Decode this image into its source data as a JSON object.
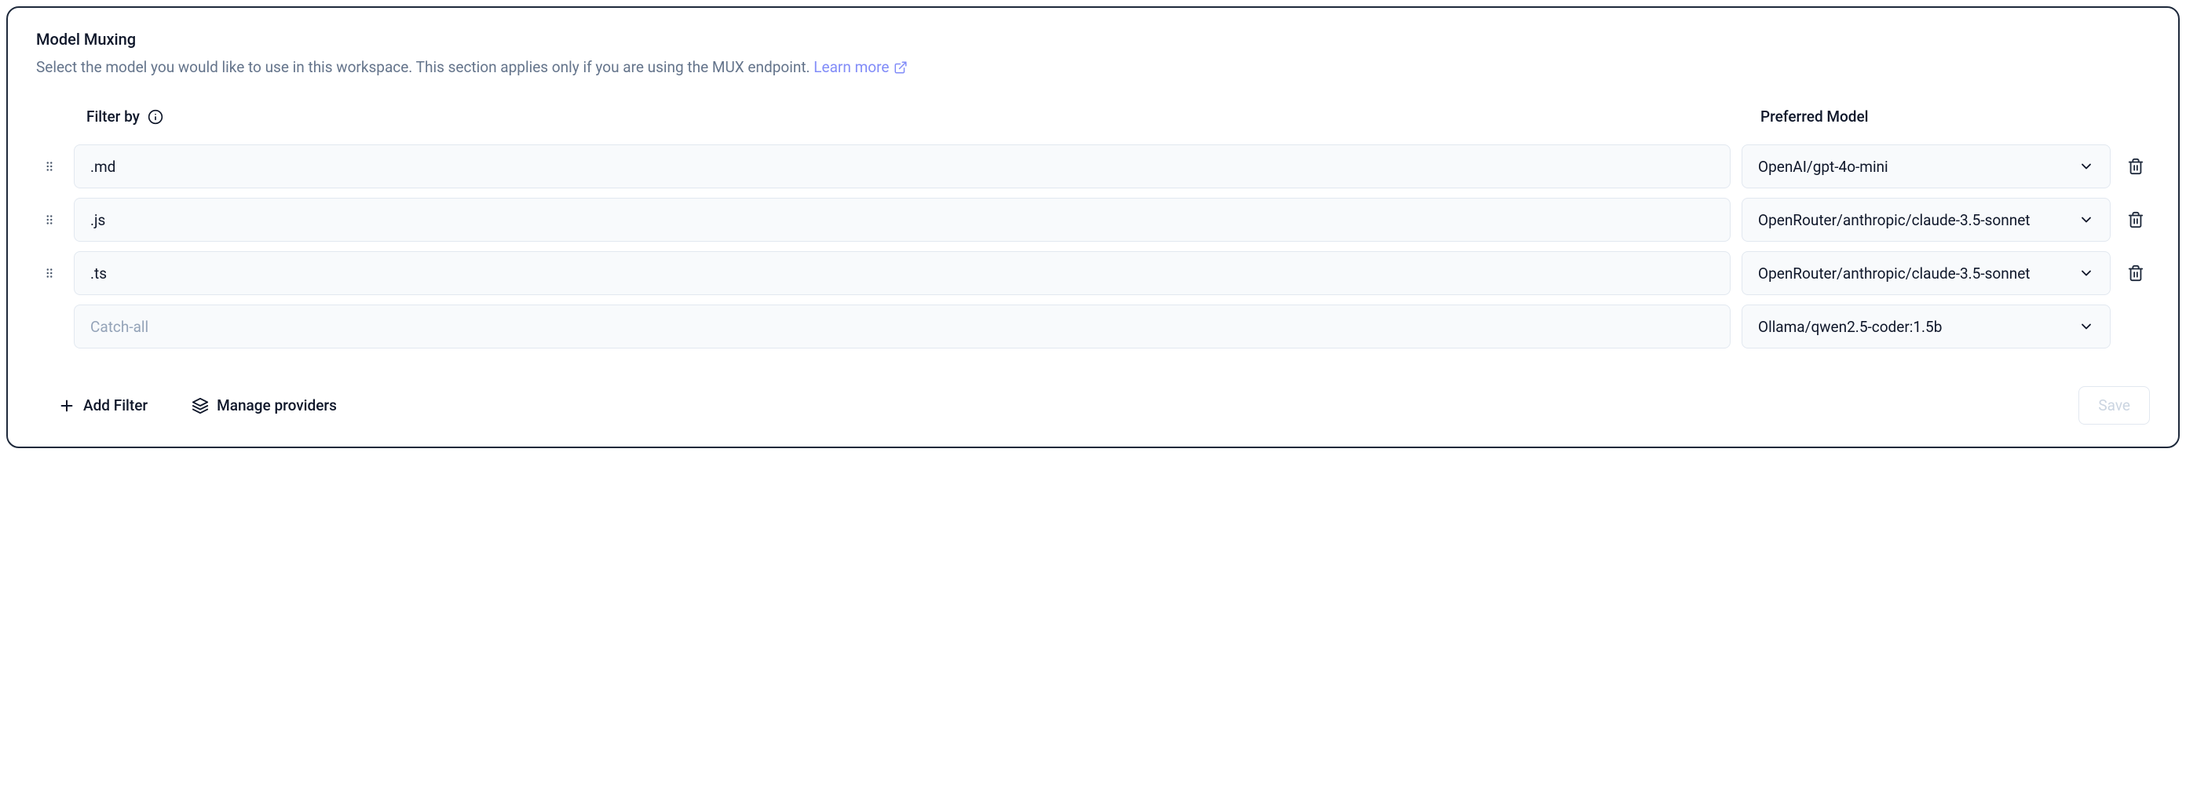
{
  "title": "Model Muxing",
  "description": "Select the model you would like to use in this workspace. This section applies only if you are using the MUX endpoint.",
  "learn_more_label": "Learn more",
  "headers": {
    "filter_by": "Filter by",
    "preferred_model": "Preferred Model"
  },
  "rows": [
    {
      "filter_value": ".md",
      "filter_placeholder": "",
      "model": "OpenAI/gpt-4o-mini",
      "has_drag": true,
      "has_delete": true
    },
    {
      "filter_value": ".js",
      "filter_placeholder": "",
      "model": "OpenRouter/anthropic/claude-3.5-sonnet",
      "has_drag": true,
      "has_delete": true
    },
    {
      "filter_value": ".ts",
      "filter_placeholder": "",
      "model": "OpenRouter/anthropic/claude-3.5-sonnet",
      "has_drag": true,
      "has_delete": true
    },
    {
      "filter_value": "",
      "filter_placeholder": "Catch-all",
      "model": "Ollama/qwen2.5-coder:1.5b",
      "has_drag": false,
      "has_delete": false
    }
  ],
  "footer": {
    "add_filter": "Add Filter",
    "manage_providers": "Manage providers",
    "save": "Save"
  }
}
